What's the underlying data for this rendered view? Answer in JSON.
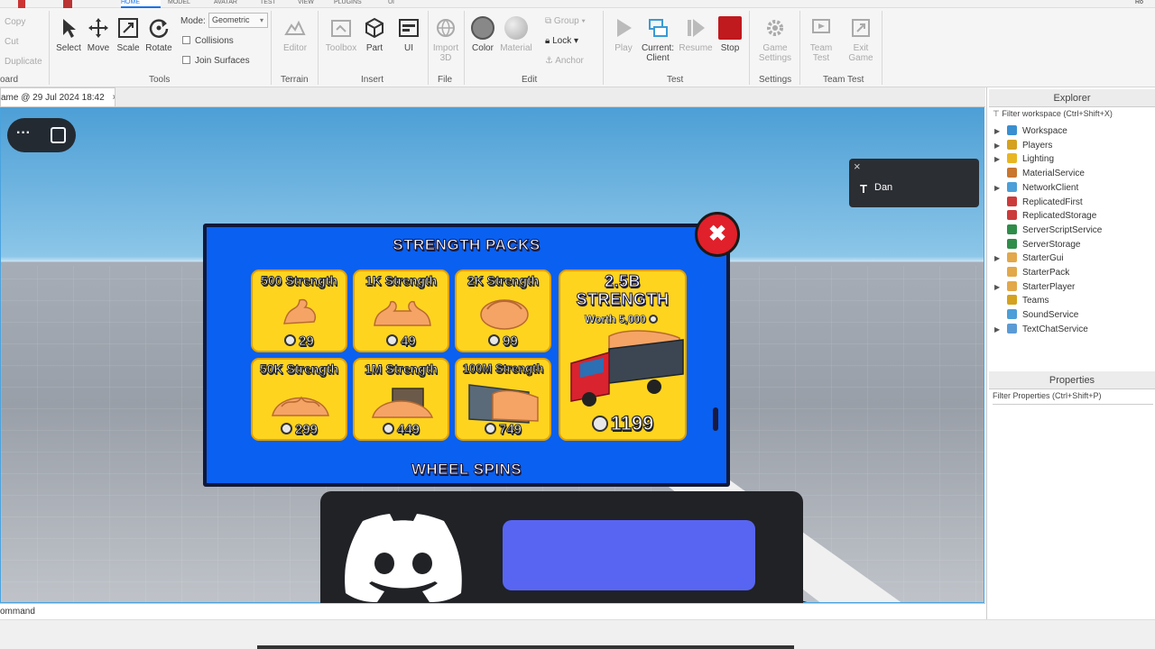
{
  "ribbon": {
    "tabs": [
      "HOME",
      "MODEL",
      "AVATAR",
      "TEST",
      "VIEW",
      "PLUGINS",
      "UI"
    ],
    "clipboard": {
      "copy": "Copy",
      "cut": "Cut",
      "duplicate": "Duplicate",
      "group": "oard"
    },
    "tools": {
      "select": "Select",
      "move": "Move",
      "scale": "Scale",
      "rotate": "Rotate",
      "mode_label": "Mode:",
      "mode_value": "Geometric",
      "collisions": "Collisions",
      "join_surfaces": "Join Surfaces",
      "group": "Tools"
    },
    "terrain": {
      "editor": "Editor",
      "group": "Terrain"
    },
    "insert": {
      "toolbox": "Toolbox",
      "part": "Part",
      "ui": "UI",
      "group": "Insert"
    },
    "file": {
      "import": "Import",
      "import2": "3D",
      "group": "File"
    },
    "edit": {
      "color": "Color",
      "material": "Material",
      "group_btn": "Group",
      "lock": "Lock",
      "anchor": "Anchor",
      "group": "Edit"
    },
    "test": {
      "play": "Play",
      "current": "Current:",
      "client": "Client",
      "resume": "Resume",
      "stop": "Stop",
      "group": "Test"
    },
    "settings": {
      "game": "Game",
      "settings": "Settings",
      "group": "Settings"
    },
    "teamtest": {
      "team": "Team",
      "test": "Test",
      "exit": "Exit",
      "game": "Game",
      "group": "Team Test"
    },
    "corner": "Ro"
  },
  "doc_tab": {
    "title": "ame @ 29 Jul 2024 18:42",
    "close": "×"
  },
  "chat_popup": {
    "close": "×",
    "user": "Dan"
  },
  "shop": {
    "title": "STRENGTH PACKS",
    "close": "✖",
    "packs": [
      {
        "label": "500 Strength",
        "price": "29"
      },
      {
        "label": "1K Strength",
        "price": "49"
      },
      {
        "label": "2K Strength",
        "price": "99"
      },
      {
        "label": "50K Strength",
        "price": "299"
      },
      {
        "label": "1M Strength",
        "price": "449"
      },
      {
        "label": "100M Strength",
        "price": "749"
      }
    ],
    "featured": {
      "line1": "2.5B",
      "line2": "STRENGTH",
      "worth": "Worth 5,000",
      "price": "1199"
    },
    "footer": "WHEEL SPINS"
  },
  "explorer": {
    "title": "Explorer",
    "filter": "Filter workspace (Ctrl+Shift+X)",
    "items": [
      {
        "name": "Workspace",
        "expand": true,
        "color": "#3a8fd0"
      },
      {
        "name": "Players",
        "expand": true,
        "color": "#d4a21f"
      },
      {
        "name": "Lighting",
        "expand": true,
        "color": "#e8b622"
      },
      {
        "name": "MaterialService",
        "expand": false,
        "color": "#c9762e"
      },
      {
        "name": "NetworkClient",
        "expand": true,
        "color": "#4c9fd8"
      },
      {
        "name": "ReplicatedFirst",
        "expand": false,
        "color": "#cc3b3b"
      },
      {
        "name": "ReplicatedStorage",
        "expand": false,
        "color": "#cc3b3b"
      },
      {
        "name": "ServerScriptService",
        "expand": false,
        "color": "#2f8d4a"
      },
      {
        "name": "ServerStorage",
        "expand": false,
        "color": "#2f8d4a"
      },
      {
        "name": "StarterGui",
        "expand": true,
        "color": "#e2a84a"
      },
      {
        "name": "StarterPack",
        "expand": false,
        "color": "#e2a84a"
      },
      {
        "name": "StarterPlayer",
        "expand": true,
        "color": "#e2a84a"
      },
      {
        "name": "Teams",
        "expand": false,
        "color": "#d4a21f"
      },
      {
        "name": "SoundService",
        "expand": false,
        "color": "#4c9fd8"
      },
      {
        "name": "TextChatService",
        "expand": true,
        "color": "#5b9bd5"
      }
    ]
  },
  "properties": {
    "title": "Properties",
    "filter": "Filter Properties (Ctrl+Shift+P)"
  },
  "command": {
    "label": "ommand"
  }
}
